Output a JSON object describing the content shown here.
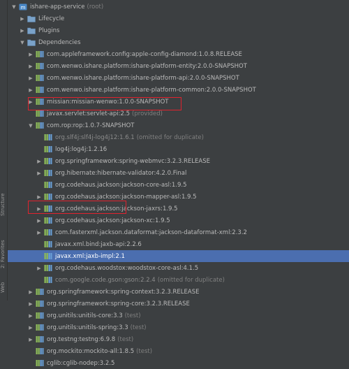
{
  "side_tabs": {
    "structure": "Structure",
    "favorites": "2: Favorites",
    "web": "Web"
  },
  "colors": {
    "selection": "#4b6eaf",
    "highlight_box": "#e0222e"
  },
  "rows": [
    {
      "label": "ishare-app-service",
      "suffix": "(root)",
      "toggle": "expanded",
      "icon": "maven-project-icon",
      "indent": 0
    },
    {
      "label": "Lifecycle",
      "suffix": "",
      "toggle": "collapsed",
      "icon": "folder-icon",
      "indent": 1
    },
    {
      "label": "Plugins",
      "suffix": "",
      "toggle": "collapsed",
      "icon": "folder-icon",
      "indent": 1
    },
    {
      "label": "Dependencies",
      "suffix": "",
      "toggle": "expanded",
      "icon": "folder-icon",
      "indent": 1
    },
    {
      "label": "com.appleframework.config:apple-config-diamond:1.0.8.RELEASE",
      "suffix": "",
      "toggle": "collapsed",
      "icon": "library-icon",
      "indent": 2
    },
    {
      "label": "com.wenwo.ishare.platform:ishare-platform-entity:2.0.0-SNAPSHOT",
      "suffix": "",
      "toggle": "collapsed",
      "icon": "library-icon",
      "indent": 2
    },
    {
      "label": "com.wenwo.ishare.platform:ishare-platform-api:2.0.0-SNAPSHOT",
      "suffix": "",
      "toggle": "collapsed",
      "icon": "library-icon",
      "indent": 2
    },
    {
      "label": "com.wenwo.ishare.platform:ishare-platform-common:2.0.0-SNAPSHOT",
      "suffix": "",
      "toggle": "collapsed",
      "icon": "library-icon",
      "indent": 2
    },
    {
      "label": "missian:missian-wenwo:1.0.0-SNAPSHOT",
      "suffix": "",
      "toggle": "collapsed",
      "icon": "library-icon",
      "indent": 2
    },
    {
      "label": "javax.servlet:servlet-api:2.5",
      "suffix": "(provided)",
      "toggle": "none",
      "icon": "library-icon",
      "indent": 2
    },
    {
      "label": "com.rop:rop:1.0.7-SNAPSHOT",
      "suffix": "",
      "toggle": "expanded",
      "icon": "library-icon",
      "indent": 2
    },
    {
      "label": "org.slf4j:slf4j-log4j12:1.6.1",
      "suffix": "(omitted for duplicate)",
      "toggle": "none",
      "icon": "library-icon",
      "indent": 3,
      "dim": true
    },
    {
      "label": "log4j:log4j:1.2.16",
      "suffix": "",
      "toggle": "none",
      "icon": "library-icon",
      "indent": 3
    },
    {
      "label": "org.springframework:spring-webmvc:3.2.3.RELEASE",
      "suffix": "",
      "toggle": "collapsed",
      "icon": "library-icon",
      "indent": 3
    },
    {
      "label": "org.hibernate:hibernate-validator:4.2.0.Final",
      "suffix": "",
      "toggle": "collapsed",
      "icon": "library-icon",
      "indent": 3
    },
    {
      "label": "org.codehaus.jackson:jackson-core-asl:1.9.5",
      "suffix": "",
      "toggle": "none",
      "icon": "library-icon",
      "indent": 3
    },
    {
      "label": "org.codehaus.jackson:jackson-mapper-asl:1.9.5",
      "suffix": "",
      "toggle": "collapsed",
      "icon": "library-icon",
      "indent": 3
    },
    {
      "label": "org.codehaus.jackson:jackson-jaxrs:1.9.5",
      "suffix": "",
      "toggle": "collapsed",
      "icon": "library-icon",
      "indent": 3
    },
    {
      "label": "org.codehaus.jackson:jackson-xc:1.9.5",
      "suffix": "",
      "toggle": "collapsed",
      "icon": "library-icon",
      "indent": 3
    },
    {
      "label": "com.fasterxml.jackson.dataformat:jackson-dataformat-xml:2.3.2",
      "suffix": "",
      "toggle": "collapsed",
      "icon": "library-icon",
      "indent": 3
    },
    {
      "label": "javax.xml.bind:jaxb-api:2.2.6",
      "suffix": "",
      "toggle": "none",
      "icon": "library-icon",
      "indent": 3
    },
    {
      "label": "javax.xml:jaxb-impl:2.1",
      "suffix": "",
      "toggle": "none",
      "icon": "library-icon",
      "indent": 3,
      "selected": true
    },
    {
      "label": "org.codehaus.woodstox:woodstox-core-asl:4.1.5",
      "suffix": "",
      "toggle": "collapsed",
      "icon": "library-icon",
      "indent": 3
    },
    {
      "label": "com.google.code.gson:gson:2.2.4",
      "suffix": "(omitted for duplicate)",
      "toggle": "none",
      "icon": "library-icon",
      "indent": 3,
      "dim": true
    },
    {
      "label": "org.springframework:spring-context:3.2.3.RELEASE",
      "suffix": "",
      "toggle": "collapsed",
      "icon": "library-icon",
      "indent": 2
    },
    {
      "label": "org.springframework:spring-core:3.2.3.RELEASE",
      "suffix": "",
      "toggle": "collapsed",
      "icon": "library-icon",
      "indent": 2
    },
    {
      "label": "org.unitils:unitils-core:3.3",
      "suffix": "(test)",
      "toggle": "collapsed",
      "icon": "library-icon",
      "indent": 2
    },
    {
      "label": "org.unitils:unitils-spring:3.3",
      "suffix": "(test)",
      "toggle": "collapsed",
      "icon": "library-icon",
      "indent": 2
    },
    {
      "label": "org.testng:testng:6.9.8",
      "suffix": "(test)",
      "toggle": "collapsed",
      "icon": "library-icon",
      "indent": 2
    },
    {
      "label": "org.mockito:mockito-all:1.8.5",
      "suffix": "(test)",
      "toggle": "none",
      "icon": "library-icon",
      "indent": 2
    },
    {
      "label": "cglib:cglib-nodep:3.2.5",
      "suffix": "",
      "toggle": "none",
      "icon": "library-icon",
      "indent": 2
    }
  ]
}
